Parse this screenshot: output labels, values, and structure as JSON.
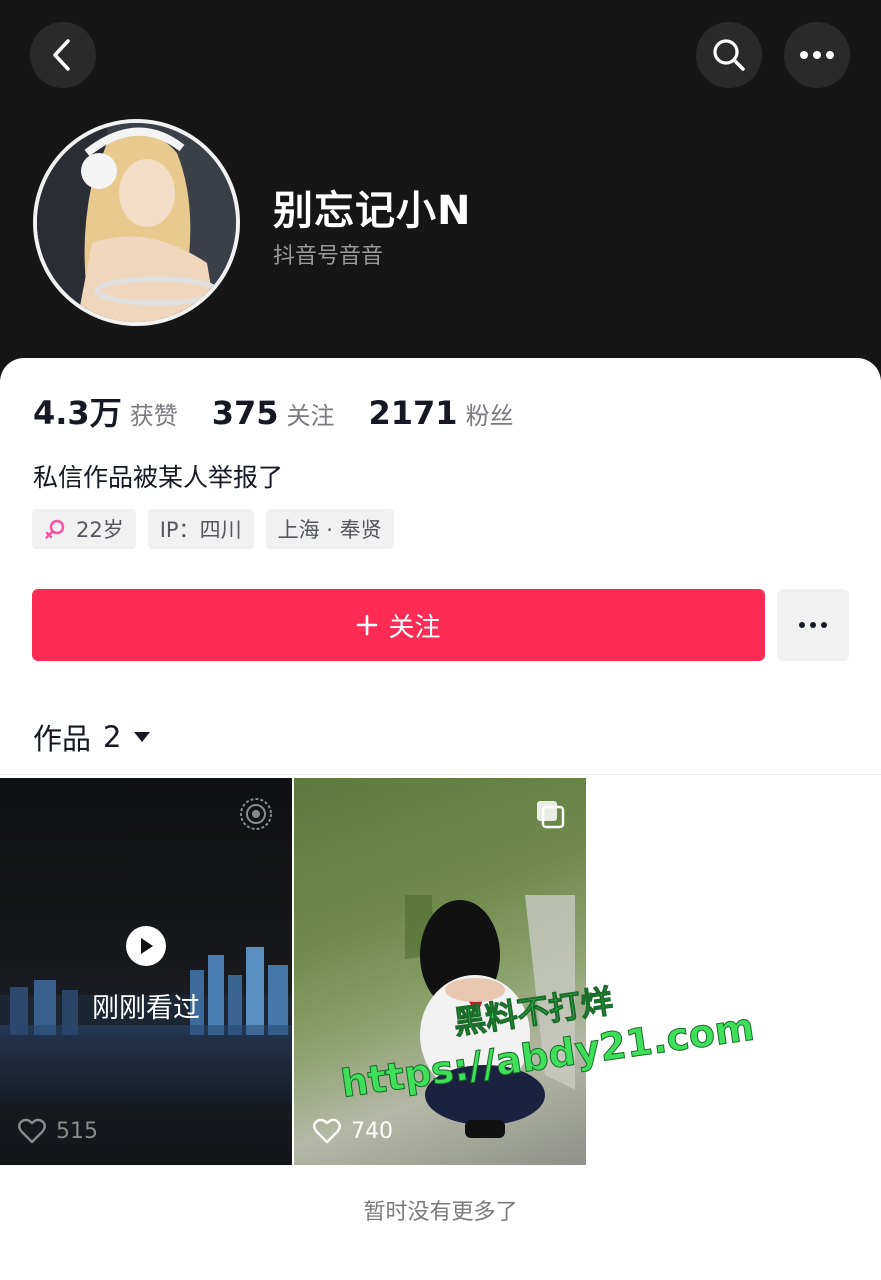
{
  "header": {
    "nickname": "别忘记小N",
    "douyin_id": "抖音号音音"
  },
  "stats": [
    {
      "value": "4.3万",
      "label": "获赞"
    },
    {
      "value": "375",
      "label": "关注"
    },
    {
      "value": "2171",
      "label": "粉丝"
    }
  ],
  "bio": "私信作品被某人举报了",
  "tags": {
    "age": "22岁",
    "ip": "IP：四川",
    "location": "上海 · 奉贤"
  },
  "actions": {
    "follow_label": "关注"
  },
  "works_tab": {
    "label": "作品",
    "count": "2"
  },
  "videos": [
    {
      "badge": "刚刚看过",
      "likes": "515"
    },
    {
      "likes": "740"
    }
  ],
  "watermark": {
    "line1": "黑料不打烊",
    "line2": "https://abdy21.com"
  },
  "footer": "暂时没有更多了",
  "colors": {
    "accent": "#fe2c55",
    "header_bg": "#161616",
    "female_icon": "#ff4fa0",
    "watermark_green": "#3ee05a"
  }
}
